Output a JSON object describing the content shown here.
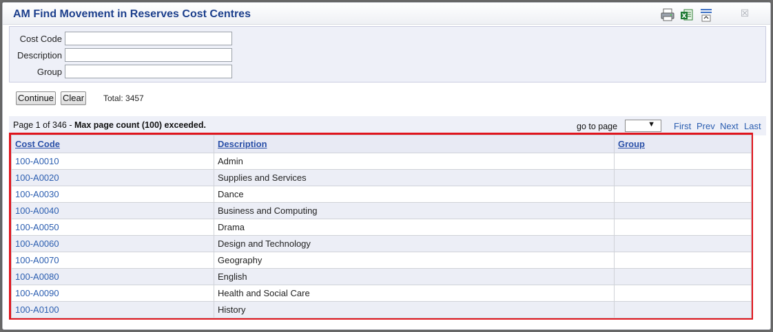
{
  "dialog": {
    "title": "AM Find Movement in Reserves Cost Centres",
    "icons": [
      "print-icon",
      "excel-export-icon",
      "collapse-criteria-icon",
      "close-icon"
    ]
  },
  "criteria": {
    "cost_code_label": "Cost Code",
    "cost_code_value": "",
    "description_label": "Description",
    "description_value": "",
    "group_label": "Group",
    "group_value": ""
  },
  "actions": {
    "continue_label": "Continue",
    "clear_label": "Clear",
    "total_text": "Total: 3457"
  },
  "pager": {
    "page_text": "Page 1 of 346 - ",
    "warning_text": "Max page count (100) exceeded.",
    "goto_label": "go to page",
    "goto_value": "",
    "first": "First",
    "prev": "Prev",
    "next": "Next",
    "last": "Last"
  },
  "grid": {
    "columns": [
      "Cost Code",
      "Description",
      "Group"
    ],
    "rows": [
      {
        "code": "100-A0010",
        "description": "Admin",
        "group": ""
      },
      {
        "code": "100-A0020",
        "description": "Supplies and Services",
        "group": ""
      },
      {
        "code": "100-A0030",
        "description": "Dance",
        "group": ""
      },
      {
        "code": "100-A0040",
        "description": "Business and Computing",
        "group": ""
      },
      {
        "code": "100-A0050",
        "description": "Drama",
        "group": ""
      },
      {
        "code": "100-A0060",
        "description": "Design and Technology",
        "group": ""
      },
      {
        "code": "100-A0070",
        "description": "Geography",
        "group": ""
      },
      {
        "code": "100-A0080",
        "description": "English",
        "group": ""
      },
      {
        "code": "100-A0090",
        "description": "Health and Social Care",
        "group": ""
      },
      {
        "code": "100-A0100",
        "description": "History",
        "group": ""
      }
    ]
  },
  "colors": {
    "title": "#1c3f8c",
    "link": "#2a5db0",
    "highlight_border": "#e0141c"
  }
}
